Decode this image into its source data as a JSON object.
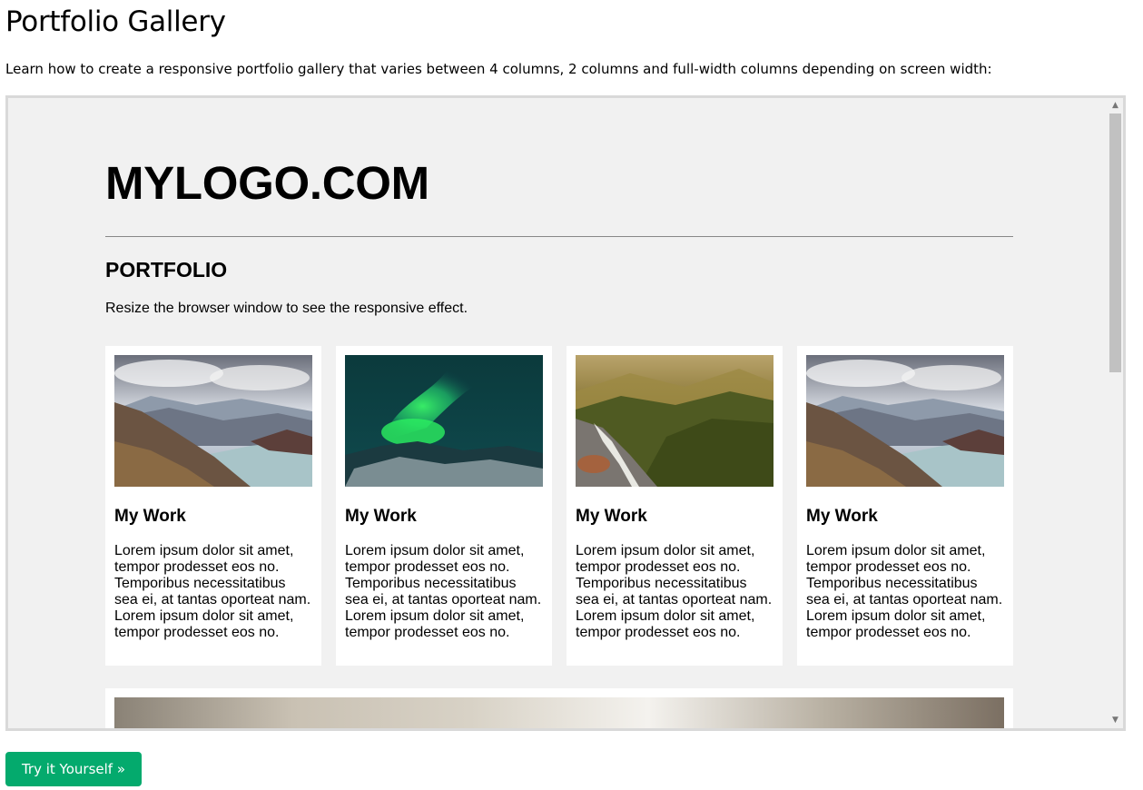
{
  "page": {
    "title": "Portfolio Gallery",
    "intro": "Learn how to create a responsive portfolio gallery that varies between 4 columns, 2 columns and full-width columns depending on screen width:"
  },
  "demo": {
    "logo": "MYLOGO.COM",
    "section_title": "PORTFOLIO",
    "section_desc": "Resize the browser window to see the responsive effect.",
    "cards": [
      {
        "title": "My Work",
        "image": "mountains",
        "text": "Lorem ipsum dolor sit amet, tempor prodesset eos no. Temporibus necessitatibus sea ei, at tantas oporteat nam. Lorem ipsum dolor sit amet, tempor prodesset eos no."
      },
      {
        "title": "My Work",
        "image": "northern-lights",
        "text": "Lorem ipsum dolor sit amet, tempor prodesset eos no. Temporibus necessitatibus sea ei, at tantas oporteat nam. Lorem ipsum dolor sit amet, tempor prodesset eos no."
      },
      {
        "title": "My Work",
        "image": "forest",
        "text": "Lorem ipsum dolor sit amet, tempor prodesset eos no. Temporibus necessitatibus sea ei, at tantas oporteat nam. Lorem ipsum dolor sit amet, tempor prodesset eos no."
      },
      {
        "title": "My Work",
        "image": "mountains",
        "text": "Lorem ipsum dolor sit amet, tempor prodesset eos no. Temporibus necessitatibus sea ei, at tantas oporteat nam. Lorem ipsum dolor sit amet, tempor prodesset eos no."
      }
    ],
    "next_card_image": "blurred-landscape"
  },
  "scrollbar": {
    "up_icon": "scroll-up-arrow",
    "down_icon": "scroll-down-arrow",
    "up_glyph": "▲",
    "down_glyph": "▼"
  },
  "button": {
    "label": "Try it Yourself »",
    "color": "#04aa6d"
  },
  "colors": {
    "frame_bg": "#f1f1f1",
    "frame_border": "#d9d9d9",
    "card_bg": "#ffffff"
  }
}
